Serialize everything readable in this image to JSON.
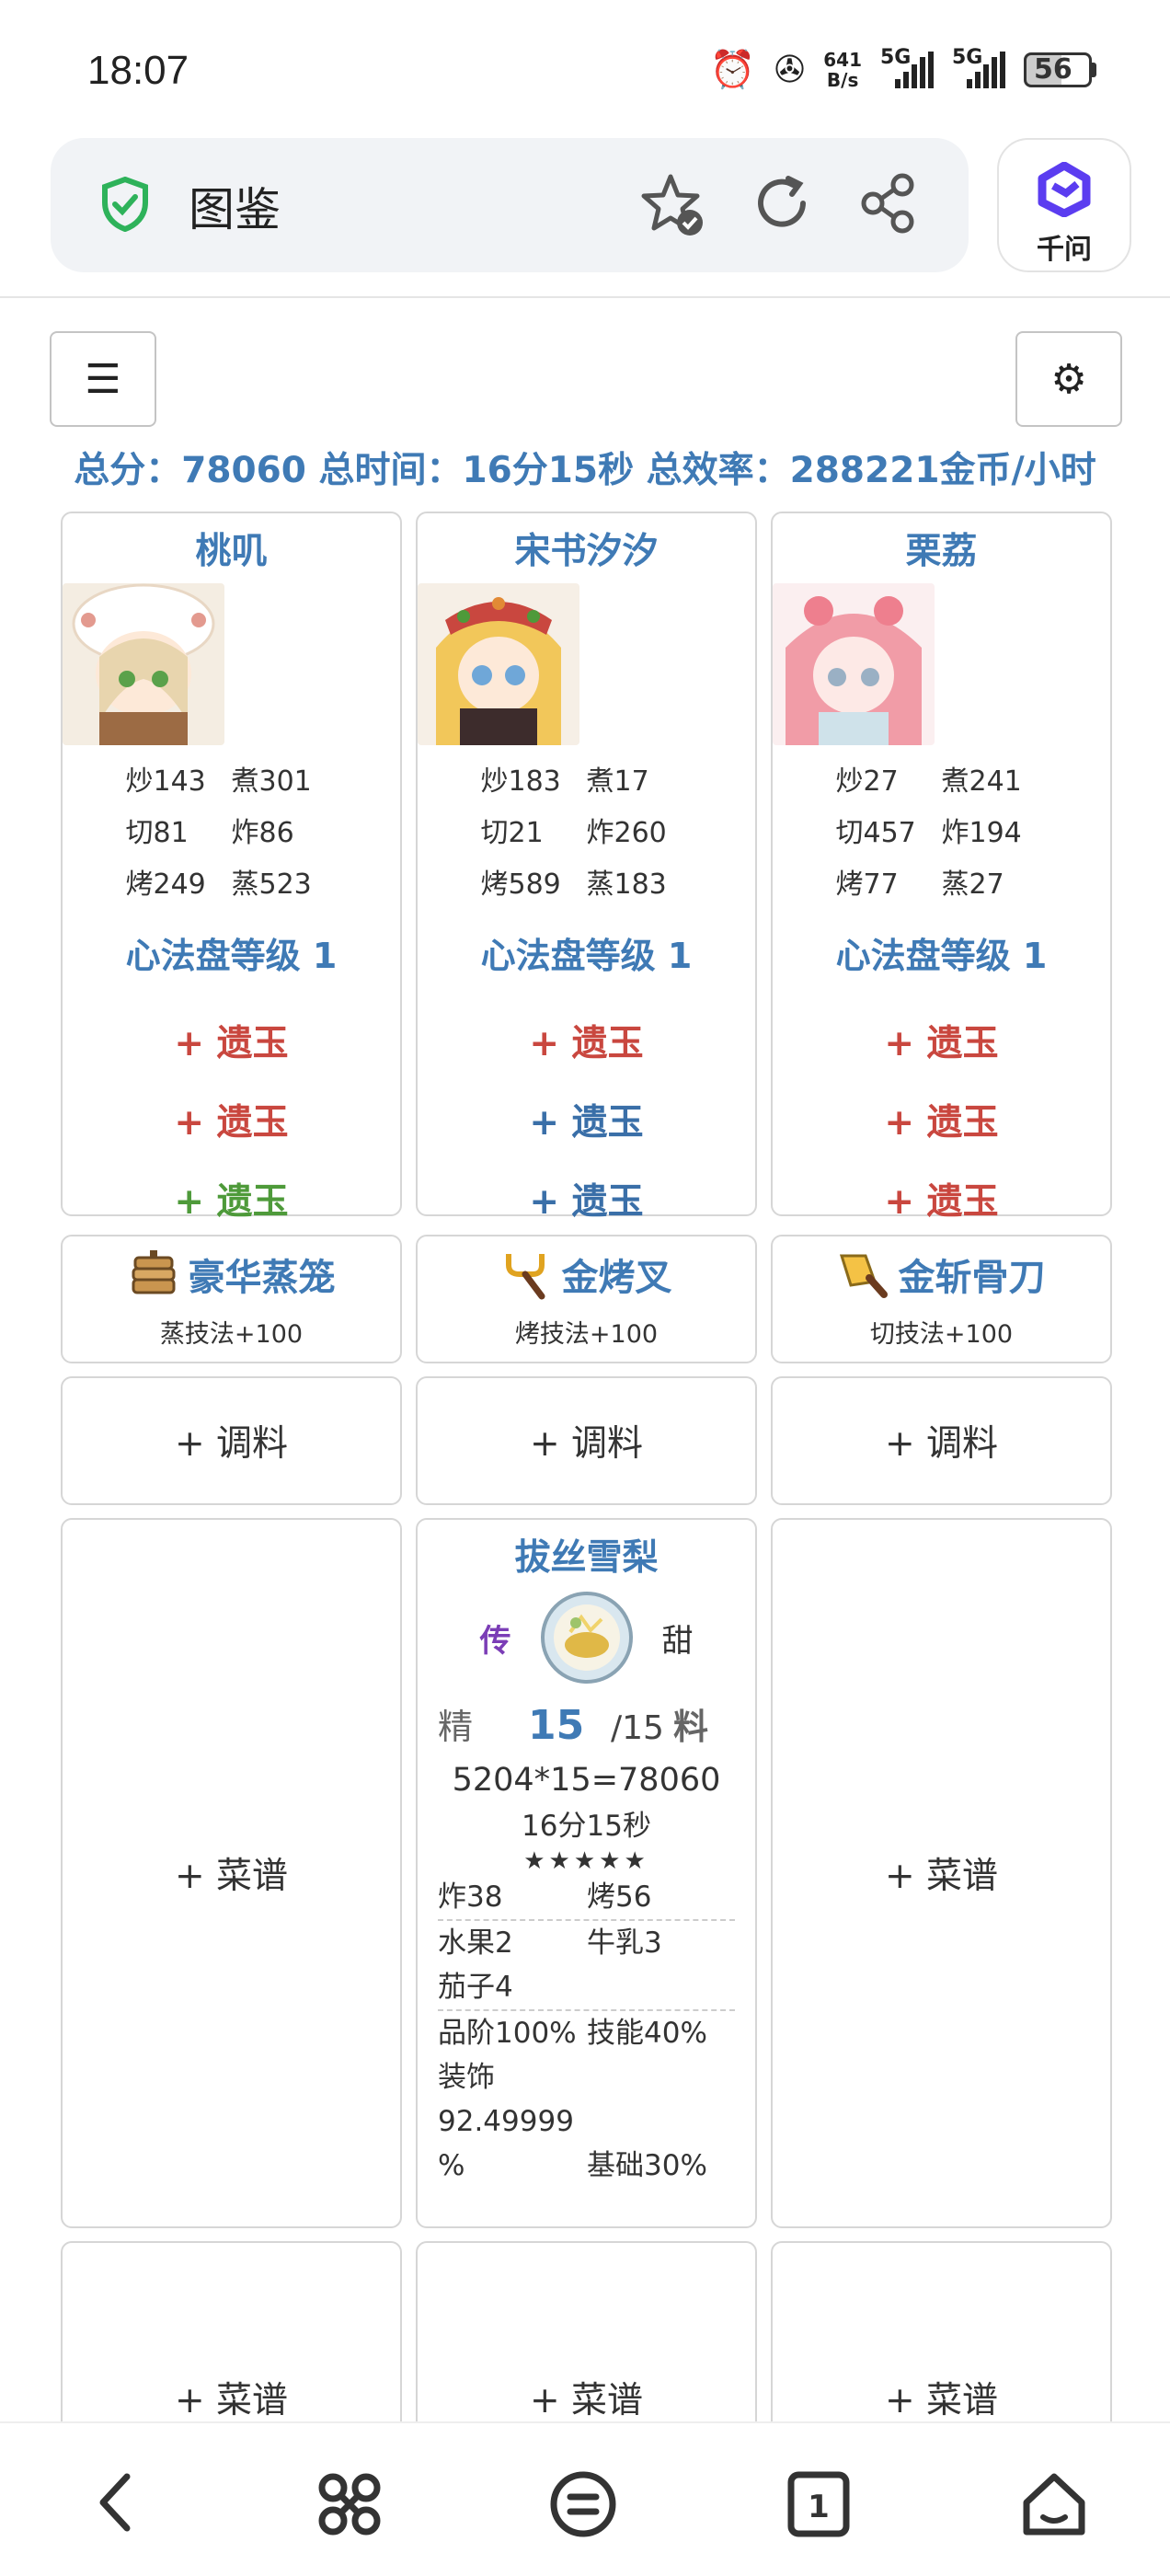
{
  "status_bar": {
    "time": "18:07",
    "net_speed_top": "641",
    "net_speed_bottom": "B/s",
    "sim1": "5G",
    "sim2": "5G",
    "battery": "56"
  },
  "browser": {
    "page_title": "图鉴",
    "assistant_label": "千问"
  },
  "summary": "总分：78060 总时间：16分15秒 总效率：288221金币/小时",
  "chefs": [
    {
      "name": "桃叽",
      "stats": [
        "炒143",
        "煮301",
        "切81",
        "炸86",
        "烤249",
        "蒸523"
      ],
      "xinfa": "心法盘等级 1",
      "yiyu": [
        {
          "label": "+ 遗玉",
          "color": "#c9473f"
        },
        {
          "label": "+ 遗玉",
          "color": "#c9473f"
        },
        {
          "label": "+ 遗玉",
          "color": "#4e9a3a"
        }
      ],
      "equip": {
        "name": "豪华蒸笼",
        "desc": "蒸技法+100",
        "icon": "steamer-icon"
      },
      "condiment": "+ 调料"
    },
    {
      "name": "宋书汐汐",
      "stats": [
        "炒183",
        "煮17",
        "切21",
        "炸260",
        "烤589",
        "蒸183"
      ],
      "xinfa": "心法盘等级 1",
      "yiyu": [
        {
          "label": "+ 遗玉",
          "color": "#c9473f"
        },
        {
          "label": "+ 遗玉",
          "color": "#3a6fa8"
        },
        {
          "label": "+ 遗玉",
          "color": "#3a6fa8"
        }
      ],
      "equip": {
        "name": "金烤叉",
        "desc": "烤技法+100",
        "icon": "fork-icon"
      },
      "condiment": "+ 调料"
    },
    {
      "name": "栗荔",
      "stats": [
        "炒27",
        "煮241",
        "切457",
        "炸194",
        "烤77",
        "蒸27"
      ],
      "xinfa": "心法盘等级 1",
      "yiyu": [
        {
          "label": "+ 遗玉",
          "color": "#c9473f"
        },
        {
          "label": "+ 遗玉",
          "color": "#c9473f"
        },
        {
          "label": "+ 遗玉",
          "color": "#c9473f"
        }
      ],
      "equip": {
        "name": "金斩骨刀",
        "desc": "切技法+100",
        "icon": "cleaver-icon"
      },
      "condiment": "+ 调料"
    }
  ],
  "recipe_slots": {
    "empty_label": "+ 菜谱"
  },
  "recipe": {
    "name": "拔丝雪梨",
    "rarity": "传",
    "taste": "甜",
    "jing": "精",
    "qty": "15",
    "max": "/15",
    "liao": "料",
    "calc": "5204*15=78060",
    "time": "16分15秒",
    "stars": "★★★★★",
    "skills": [
      "炸38",
      "烤56"
    ],
    "ingredients": [
      "水果2",
      "牛乳3",
      "茄子4",
      ""
    ],
    "bonus": [
      "品阶100%",
      "技能40%",
      "装饰",
      "",
      "92.49999",
      "",
      "%",
      "基础30%"
    ]
  },
  "bottom_row": [
    "+ 菜谱",
    "+ 菜谱",
    "+ 菜谱"
  ],
  "colors": {
    "accent": "#3f7ab5",
    "red": "#c9473f",
    "green": "#4e9a3a",
    "purple": "#7b3db6"
  }
}
